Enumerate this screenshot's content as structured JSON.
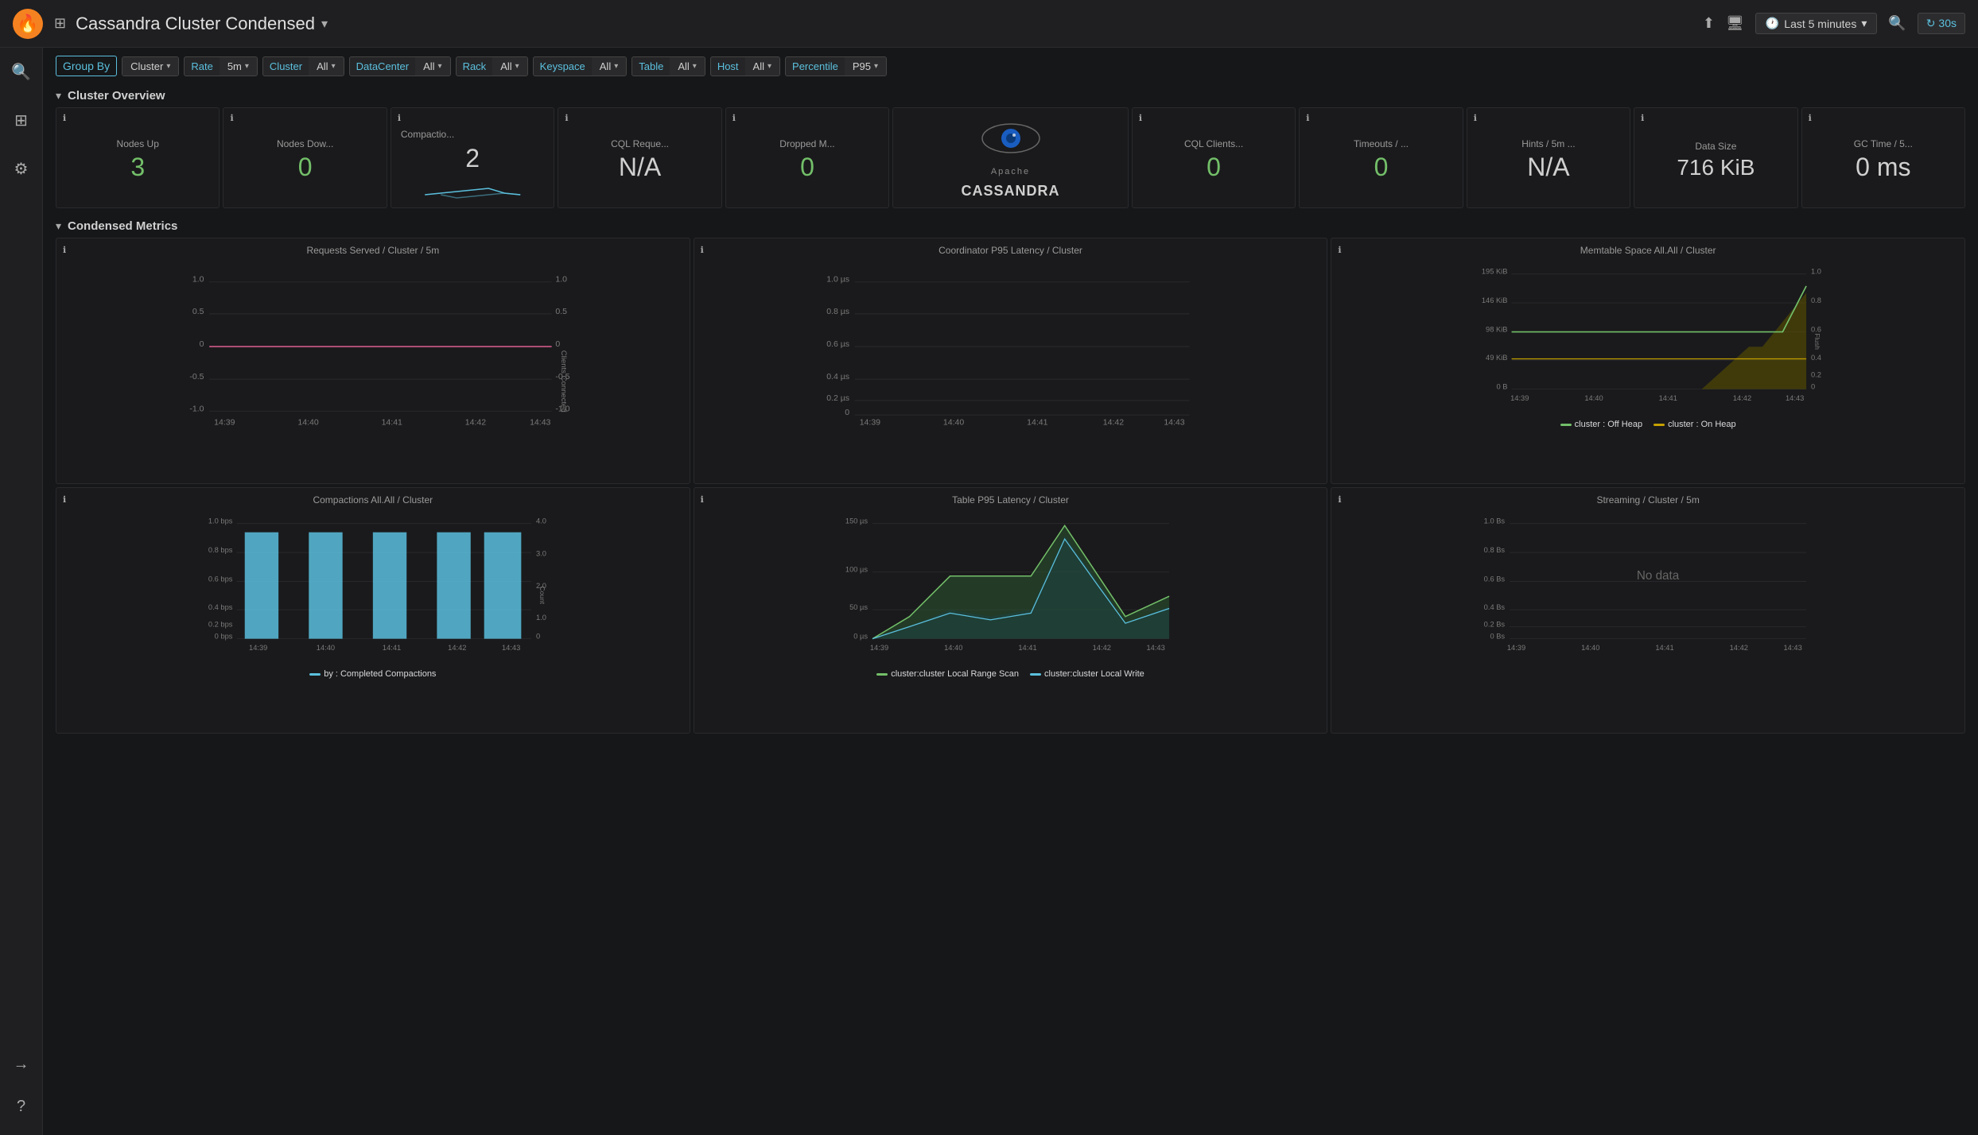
{
  "topbar": {
    "logo": "🔥",
    "grid_icon": "⊞",
    "title": "Cassandra Cluster Condensed",
    "title_arrow": "▾",
    "actions": {
      "share": "↑",
      "tv": "🖥",
      "time_range": "Last 5 minutes",
      "search": "🔍",
      "refresh": "30s"
    }
  },
  "sidebar": {
    "icons": [
      "⊞",
      "⚙"
    ],
    "bottom_icons": [
      "→",
      "?"
    ]
  },
  "filterbar": {
    "group_by_label": "Group By",
    "filters": [
      {
        "label": "Cluster",
        "value": "Cluster",
        "has_arrow": true
      },
      {
        "label": "Rate",
        "value": "5m",
        "has_arrow": true
      },
      {
        "label": "Cluster",
        "value": "All",
        "has_arrow": true
      },
      {
        "label": "DataCenter",
        "value": "All",
        "has_arrow": true
      },
      {
        "label": "Rack",
        "value": "All",
        "has_arrow": true
      },
      {
        "label": "Keyspace",
        "value": "All",
        "has_arrow": true
      },
      {
        "label": "Table",
        "value": "All",
        "has_arrow": true
      },
      {
        "label": "Host",
        "value": "All",
        "has_arrow": true
      },
      {
        "label": "Percentile",
        "value": "P95",
        "has_arrow": true
      }
    ]
  },
  "cluster_overview": {
    "section_title": "Cluster Overview",
    "cards": [
      {
        "id": "nodes-up",
        "title": "Nodes Up",
        "value": "3",
        "color": "green",
        "type": "stat"
      },
      {
        "id": "nodes-down",
        "title": "Nodes Dow...",
        "value": "0",
        "color": "green",
        "type": "stat"
      },
      {
        "id": "compactions",
        "title": "Compactio...",
        "value": "2",
        "color": "white",
        "type": "sparkline"
      },
      {
        "id": "cql-requests",
        "title": "CQL Reque...",
        "value": "N/A",
        "color": "white",
        "type": "stat"
      },
      {
        "id": "dropped-messages",
        "title": "Dropped M...",
        "value": "0",
        "color": "green",
        "type": "stat"
      },
      {
        "id": "cassandra-logo",
        "title": "",
        "type": "logo"
      },
      {
        "id": "cql-clients",
        "title": "CQL Clients...",
        "value": "0",
        "color": "green",
        "type": "stat"
      },
      {
        "id": "timeouts",
        "title": "Timeouts / ...",
        "value": "0",
        "color": "green",
        "type": "stat"
      },
      {
        "id": "hints",
        "title": "Hints / 5m ...",
        "value": "N/A",
        "color": "white",
        "type": "stat"
      },
      {
        "id": "data-size",
        "title": "Data Size",
        "value": "716 KiB",
        "color": "white",
        "type": "stat"
      },
      {
        "id": "gc-time",
        "title": "GC Time / 5...",
        "value": "0 ms",
        "color": "white",
        "type": "stat"
      }
    ]
  },
  "condensed_metrics": {
    "section_title": "Condensed Metrics",
    "charts": [
      {
        "id": "requests-served",
        "title": "Requests Served / Cluster / 5m",
        "y_axis": [
          "-1.0",
          "-0.5",
          "0",
          "0.5",
          "1.0"
        ],
        "y_axis_right": [
          "-1.0",
          "-0.5",
          "0",
          "0.5",
          "1.0"
        ],
        "y_axis_right_label": "Clients Connected",
        "x_axis": [
          "14:39",
          "14:40",
          "14:41",
          "14:42",
          "14:43"
        ],
        "type": "line_flat"
      },
      {
        "id": "coordinator-latency",
        "title": "Coordinator P95 Latency / Cluster",
        "y_axis": [
          "0",
          "0.2 µs",
          "0.4 µs",
          "0.6 µs",
          "0.8 µs",
          "1.0 µs"
        ],
        "x_axis": [
          "14:39",
          "14:40",
          "14:41",
          "14:42",
          "14:43"
        ],
        "type": "line_empty"
      },
      {
        "id": "memtable-space",
        "title": "Memtable Space All.All / Cluster",
        "y_axis": [
          "0 B",
          "49 KiB",
          "98 KiB",
          "146 KiB",
          "195 KiB"
        ],
        "y_axis_right": [
          "0",
          "0.2",
          "0.4",
          "0.6",
          "0.8",
          "1.0"
        ],
        "y_axis_right_label": "Flush",
        "x_axis": [
          "14:39",
          "14:40",
          "14:41",
          "14:42",
          "14:43"
        ],
        "legend": [
          {
            "label": "cluster : Off Heap",
            "color": "#73bf69"
          },
          {
            "label": "cluster : On Heap",
            "color": "#c5a000"
          }
        ],
        "type": "area_chart"
      },
      {
        "id": "compactions",
        "title": "Compactions All.All / Cluster",
        "y_axis": [
          "0 bps",
          "0.2 bps",
          "0.4 bps",
          "0.6 bps",
          "0.8 bps",
          "1.0 bps"
        ],
        "y_axis_right": [
          "0",
          "1.0",
          "2.0",
          "3.0",
          "4.0"
        ],
        "y_axis_right_label": "Count",
        "x_axis": [
          "14:39",
          "14:40",
          "14:41",
          "14:42",
          "14:43"
        ],
        "legend": [
          {
            "label": "by : Completed Compactions",
            "color": "#5bc0de"
          }
        ],
        "type": "bar_chart"
      },
      {
        "id": "table-latency",
        "title": "Table P95 Latency / Cluster",
        "y_axis": [
          "0 µs",
          "50 µs",
          "100 µs",
          "150 µs"
        ],
        "x_axis": [
          "14:39",
          "14:40",
          "14:41",
          "14:42",
          "14:43"
        ],
        "legend": [
          {
            "label": "cluster:cluster Local Range Scan",
            "color": "#73bf69"
          },
          {
            "label": "cluster:cluster Local Write",
            "color": "#5bc0de"
          }
        ],
        "type": "area_line"
      },
      {
        "id": "streaming",
        "title": "Streaming / Cluster / 5m",
        "y_axis": [
          "0 Bs",
          "0.2 Bs",
          "0.4 Bs",
          "0.6 Bs",
          "0.8 Bs",
          "1.0 Bs"
        ],
        "x_axis": [
          "14:39",
          "14:40",
          "14:41",
          "14:42",
          "14:43"
        ],
        "no_data": "No data",
        "type": "no_data"
      }
    ]
  },
  "colors": {
    "accent": "#f58220",
    "cyan": "#5bc0de",
    "green": "#73bf69",
    "yellow": "#c5a000",
    "dark_bg": "#161719",
    "panel_bg": "#1a1a1c",
    "border": "#2a2a2e"
  }
}
